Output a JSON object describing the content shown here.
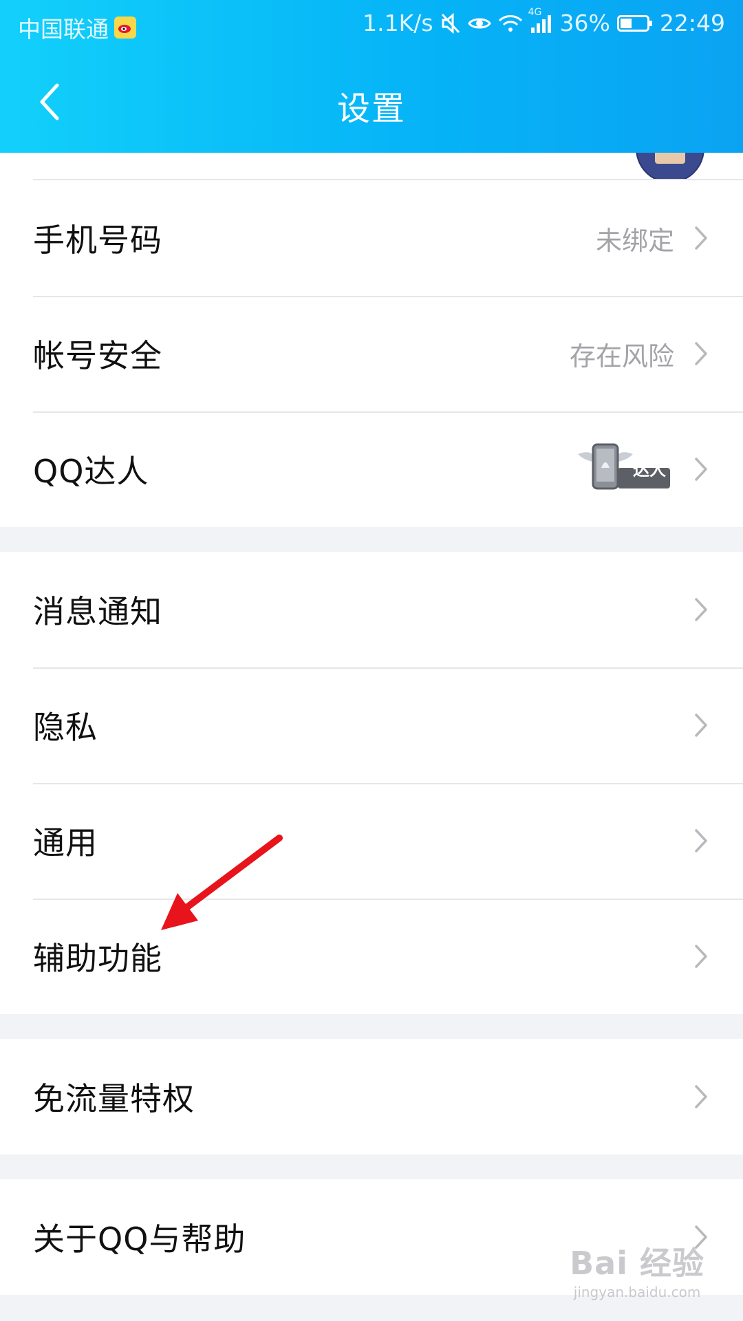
{
  "status_bar": {
    "carrier": "中国联通",
    "net_speed": "1.1K/s",
    "network_type": "4G",
    "battery": "36%",
    "time": "22:49"
  },
  "nav": {
    "title": "设置"
  },
  "groups": [
    {
      "rows": [
        {
          "label": "手机号码",
          "value": "未绑定"
        },
        {
          "label": "帐号安全",
          "value": "存在风险"
        },
        {
          "label": "QQ达人",
          "badge": "达人"
        }
      ]
    },
    {
      "rows": [
        {
          "label": "消息通知"
        },
        {
          "label": "隐私"
        },
        {
          "label": "通用"
        },
        {
          "label": "辅助功能"
        }
      ]
    },
    {
      "rows": [
        {
          "label": "免流量特权"
        }
      ]
    },
    {
      "rows": [
        {
          "label": "关于QQ与帮助"
        }
      ]
    }
  ],
  "watermark": {
    "main": "Bai 经验",
    "sub": "jingyan.baidu.com"
  },
  "colors": {
    "header_start": "#12d0fb",
    "header_end": "#0aa3f3",
    "annotation_arrow": "#e8141b"
  }
}
